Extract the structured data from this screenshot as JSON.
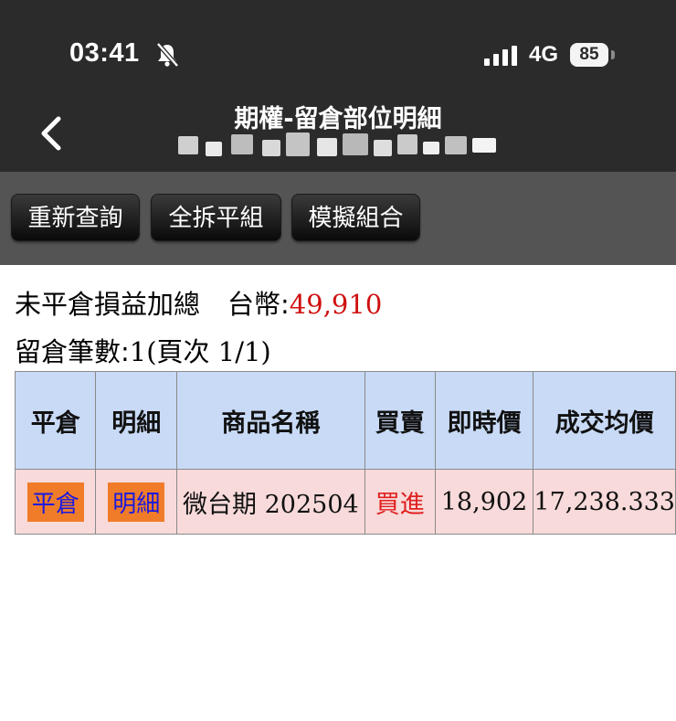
{
  "status_bar": {
    "time": "03:41",
    "network": "4G",
    "battery": "85",
    "icons": [
      "bell-slash-icon",
      "signal-icon",
      "battery-icon"
    ]
  },
  "header": {
    "title": "期權-留倉部位明細",
    "back_icon": "chevron-left-icon"
  },
  "toolbar": {
    "requery_label": "重新查詢",
    "close_all_label": "全拆平組",
    "simulate_label": "模擬組合"
  },
  "summary": {
    "pnl_label": "未平倉損益加總",
    "currency_label": "台幣:",
    "pnl_value": "49,910",
    "count_label": "留倉筆數:",
    "count_value": "1(頁次 1/1)"
  },
  "table": {
    "headers": [
      "平倉",
      "明細",
      "商品名稱",
      "買賣",
      "即時價",
      "成交均價"
    ],
    "rows": [
      {
        "close_btn": "平倉",
        "detail_btn": "明細",
        "product": "微台期",
        "contract": "202504",
        "side": "買進",
        "last_price": "18,902",
        "avg_price": "17,238.333"
      }
    ]
  },
  "colors": {
    "header_bg": "#2b2b2b",
    "toolbar_bg": "#545454",
    "table_header_bg": "#c8daf6",
    "table_row_bg": "#f8dada",
    "accent_red": "#d01010",
    "cell_button_bg": "#f07c2a",
    "cell_button_text": "#1a1adf"
  }
}
